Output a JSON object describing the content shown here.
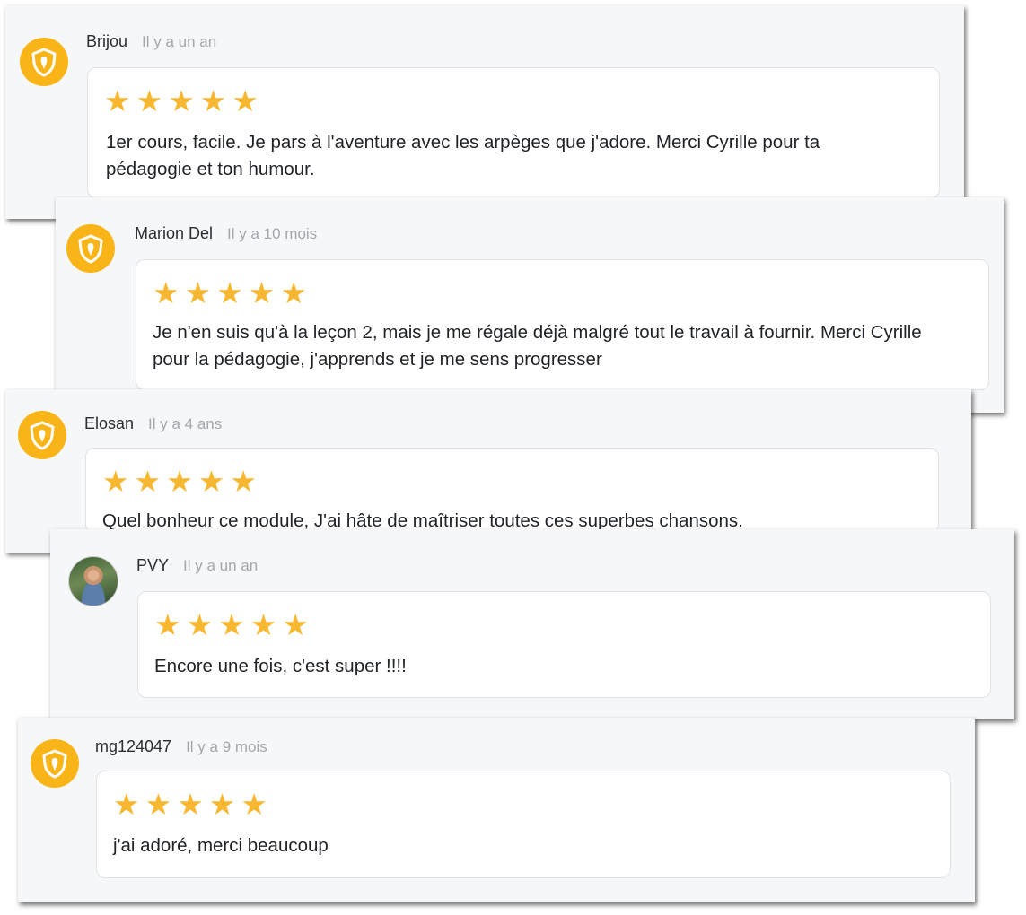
{
  "reviews": [
    {
      "author": "Brijou",
      "time": "Il y a un an",
      "avatar_icon": "carrot-shield-icon",
      "rating": 5,
      "text": "1er cours, facile. Je pars à l'aventure avec les arpèges que j'adore. Merci Cyrille pour ta pédagogie et ton humour."
    },
    {
      "author": "Marion Del",
      "time": "Il y a 10 mois",
      "avatar_icon": "carrot-shield-icon",
      "rating": 5,
      "text": "Je n'en suis qu'à la leçon 2, mais je me régale déjà malgré tout le travail à fournir. Merci Cyrille pour la pédagogie, j'apprends et je me sens progresser"
    },
    {
      "author": "Elosan",
      "time": "Il y a 4 ans",
      "avatar_icon": "carrot-shield-icon",
      "rating": 5,
      "text": "Quel bonheur ce module, J'ai hâte de maîtriser toutes ces superbes chansons."
    },
    {
      "author": "PVY",
      "time": "Il y a un an",
      "avatar_icon": "user-photo",
      "rating": 5,
      "text": "Encore une fois, c'est super !!!!"
    },
    {
      "author": "mg124047",
      "time": "Il y a 9 mois",
      "avatar_icon": "carrot-shield-icon",
      "rating": 5,
      "text": "j'ai adoré, merci beaucoup"
    }
  ],
  "colors": {
    "star": "#f7b731",
    "avatar": "#f9b418",
    "panel": "#f6f7f9",
    "card": "#ffffff",
    "time_text": "#a3a7ad"
  }
}
